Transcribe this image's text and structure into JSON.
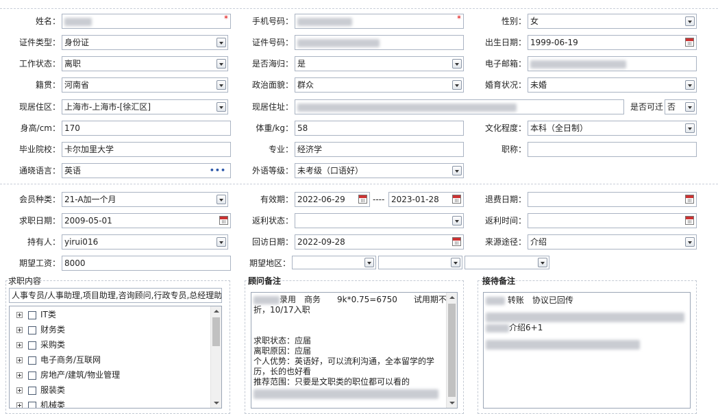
{
  "personal": {
    "name": {
      "label": "姓名：",
      "value": "",
      "required_mark": "*"
    },
    "mobile": {
      "label": "手机号码：",
      "value": "",
      "required_mark": "*"
    },
    "gender": {
      "label": "性别：",
      "value": "女"
    },
    "id_type": {
      "label": "证件类型：",
      "value": "身份证"
    },
    "id_number": {
      "label": "证件号码：",
      "value": ""
    },
    "birth_date": {
      "label": "出生日期：",
      "value": "1999-06-19"
    },
    "work_status": {
      "label": "工作状态：",
      "value": "离职"
    },
    "returnee": {
      "label": "是否海归：",
      "value": "是"
    },
    "email": {
      "label": "电子邮箱：",
      "value": ""
    },
    "native_place": {
      "label": "籍贯：",
      "value": "河南省"
    },
    "political": {
      "label": "政治面貌：",
      "value": "群众"
    },
    "marital": {
      "label": "婚育状况：",
      "value": "未婚"
    },
    "residence_area": {
      "label": "现居住区：",
      "value": "上海市-上海市-[徐汇区]"
    },
    "residence_address": {
      "label": "现居住址：",
      "value": ""
    },
    "relocate": {
      "label": "是否可迁",
      "value": "否"
    },
    "height": {
      "label": "身高/cm：",
      "value": "170"
    },
    "weight": {
      "label": "体重/kg：",
      "value": "58"
    },
    "education": {
      "label": "文化程度：",
      "value": "本科（全日制）"
    },
    "school": {
      "label": "毕业院校：",
      "value": "卡尔加里大学"
    },
    "major": {
      "label": "专业：",
      "value": "经济学"
    },
    "title": {
      "label": "职称：",
      "value": ""
    },
    "language": {
      "label": "通晓语言：",
      "value": "英语",
      "more": "•••"
    },
    "language_level": {
      "label": "外语等级：",
      "value": "未考级（口语好）"
    }
  },
  "membership": {
    "member_type": {
      "label": "会员种类：",
      "value": "21-A加一个月"
    },
    "valid_period": {
      "label": "有效期：",
      "from": "2022-06-29",
      "sep": "----",
      "to": "2023-01-28"
    },
    "refund_date": {
      "label": "退费日期：",
      "value": ""
    },
    "job_date": {
      "label": "求职日期：",
      "value": "2009-05-01"
    },
    "rebate_status": {
      "label": "返利状态：",
      "value": ""
    },
    "rebate_time": {
      "label": "返利时间：",
      "value": ""
    },
    "holder": {
      "label": "持有人：",
      "value": "yirui016"
    },
    "visit_date": {
      "label": "回访日期：",
      "value": "2022-09-28"
    },
    "source": {
      "label": "来源途径：",
      "value": "介绍"
    },
    "expected_salary": {
      "label": "期望工资：",
      "value": "8000"
    },
    "expected_area": {
      "label": "期望地区：",
      "values": [
        "",
        "",
        ""
      ]
    }
  },
  "job_content": {
    "title": "求职内容",
    "summary": "人事专员/人事助理,项目助理,咨询顾问,行政专员,总经理助",
    "categories": [
      "IT类",
      "财务类",
      "采购类",
      "电子商务/互联网",
      "房地产/建筑/物业管理",
      "服装类",
      "机械类"
    ]
  },
  "consultant_notes": {
    "title": "顾问备注",
    "lines": [
      "录用　商务　　9k*0.75=6750　　试用期不打",
      "折，10/17入职",
      "",
      "",
      "求职状态：应届",
      "离职原因：应届",
      "个人优势：英语好，可以流利沟通，全本留学的学",
      "历，长的也好看",
      "推荐范围：只要是文职类的职位都可以看的"
    ]
  },
  "reception_notes": {
    "title": "接待备注",
    "line1": "转账　协议已回传",
    "line2": "介绍6+1"
  },
  "colors": {
    "border": "#a9b3c2",
    "required": "#dd0000",
    "accent": "#2a56a8"
  }
}
